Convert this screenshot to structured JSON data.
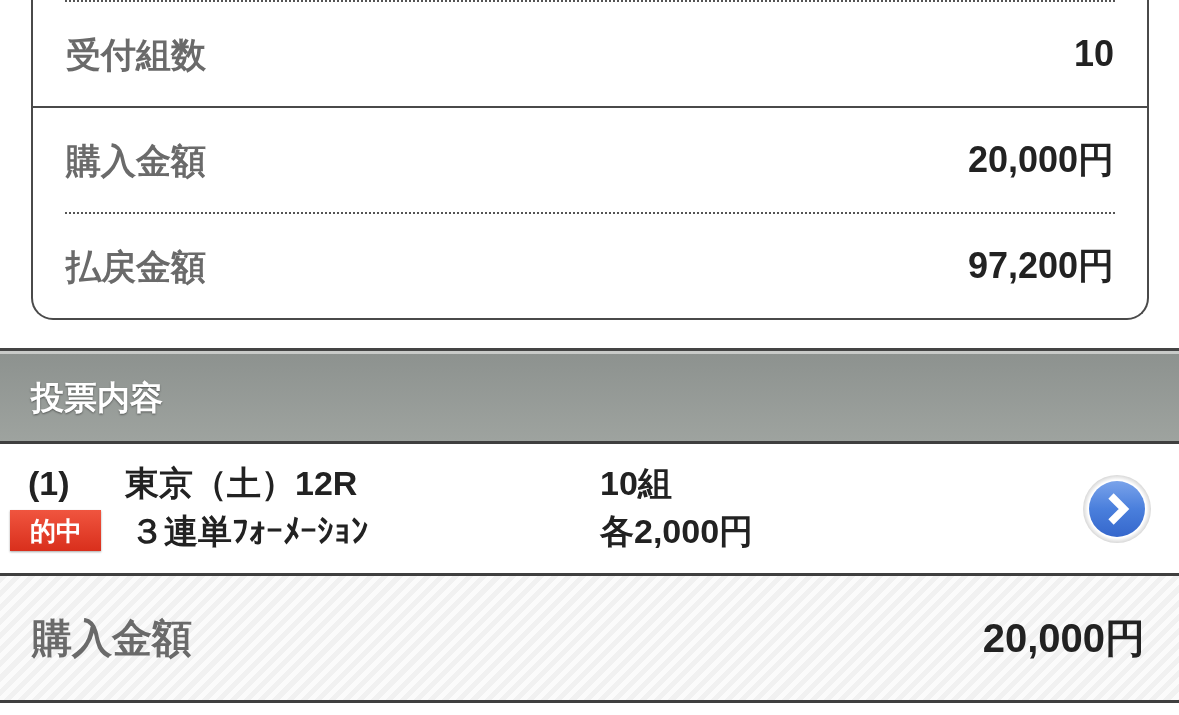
{
  "summary": {
    "groups": [
      {
        "rows": [
          {
            "label": "受付組数",
            "value": "10"
          }
        ]
      },
      {
        "rows": [
          {
            "label": "購入金額",
            "value": "20,000円"
          },
          {
            "label": "払戻金額",
            "value": "97,200円"
          }
        ]
      }
    ]
  },
  "section": {
    "title": "投票内容"
  },
  "bets": [
    {
      "number": "(1)",
      "race": "東京（土）12R",
      "combinations": "10組",
      "badge": "的中",
      "bet_type": "３連単ﾌｫｰﾒｰｼｮﾝ",
      "stake": "各2,000円"
    }
  ],
  "total": {
    "label": "購入金額",
    "value": "20,000円"
  }
}
